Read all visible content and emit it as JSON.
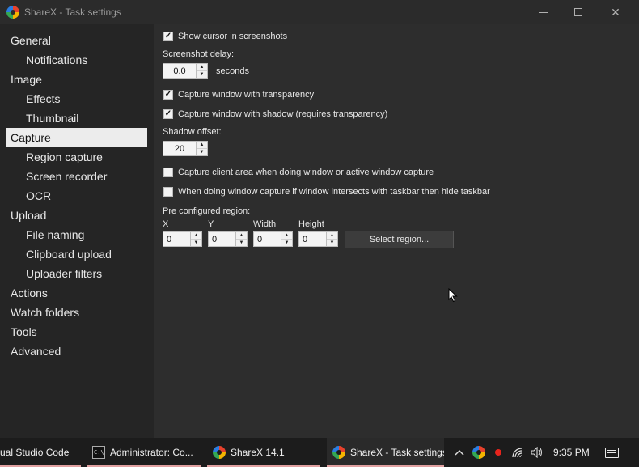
{
  "window": {
    "title": "ShareX - Task settings"
  },
  "sidebar": {
    "items": [
      {
        "label": "General",
        "level": 0,
        "selected": false
      },
      {
        "label": "Notifications",
        "level": 1,
        "selected": false
      },
      {
        "label": "Image",
        "level": 0,
        "selected": false
      },
      {
        "label": "Effects",
        "level": 1,
        "selected": false
      },
      {
        "label": "Thumbnail",
        "level": 1,
        "selected": false
      },
      {
        "label": "Capture",
        "level": 0,
        "selected": true
      },
      {
        "label": "Region capture",
        "level": 1,
        "selected": false
      },
      {
        "label": "Screen recorder",
        "level": 1,
        "selected": false
      },
      {
        "label": "OCR",
        "level": 1,
        "selected": false
      },
      {
        "label": "Upload",
        "level": 0,
        "selected": false
      },
      {
        "label": "File naming",
        "level": 1,
        "selected": false
      },
      {
        "label": "Clipboard upload",
        "level": 1,
        "selected": false
      },
      {
        "label": "Uploader filters",
        "level": 1,
        "selected": false
      },
      {
        "label": "Actions",
        "level": 0,
        "selected": false
      },
      {
        "label": "Watch folders",
        "level": 0,
        "selected": false
      },
      {
        "label": "Tools",
        "level": 0,
        "selected": false
      },
      {
        "label": "Advanced",
        "level": 0,
        "selected": false
      }
    ]
  },
  "capture": {
    "show_cursor": {
      "label": "Show cursor in screenshots",
      "checked": true
    },
    "screenshot_delay": {
      "label": "Screenshot delay:",
      "value": "0.0",
      "unit": "seconds"
    },
    "transparency": {
      "label": "Capture window with transparency",
      "checked": true
    },
    "shadow": {
      "label": "Capture window with shadow (requires transparency)",
      "checked": true
    },
    "shadow_offset": {
      "label": "Shadow offset:",
      "value": "20"
    },
    "client_area": {
      "label": "Capture client area when doing window or active window capture",
      "checked": false
    },
    "hide_taskbar": {
      "label": "When doing window capture if window intersects with taskbar then hide taskbar",
      "checked": false
    },
    "region": {
      "label": "Pre configured region:",
      "x_label": "X",
      "x_value": "0",
      "y_label": "Y",
      "y_value": "0",
      "width_label": "Width",
      "width_value": "0",
      "height_label": "Height",
      "height_value": "0",
      "select_button": "Select region..."
    }
  },
  "taskbar": {
    "items": [
      {
        "label": "ual Studio Code"
      },
      {
        "label": "Administrator: Co..."
      },
      {
        "label": "ShareX 14.1"
      },
      {
        "label": "ShareX - Task settings"
      }
    ],
    "clock": "9:35 PM"
  },
  "colors": {
    "selected_bg": "#ececec",
    "content_bg": "#2d2d2d",
    "sidebar_bg": "#252525",
    "record_dot": "#e8241c"
  }
}
